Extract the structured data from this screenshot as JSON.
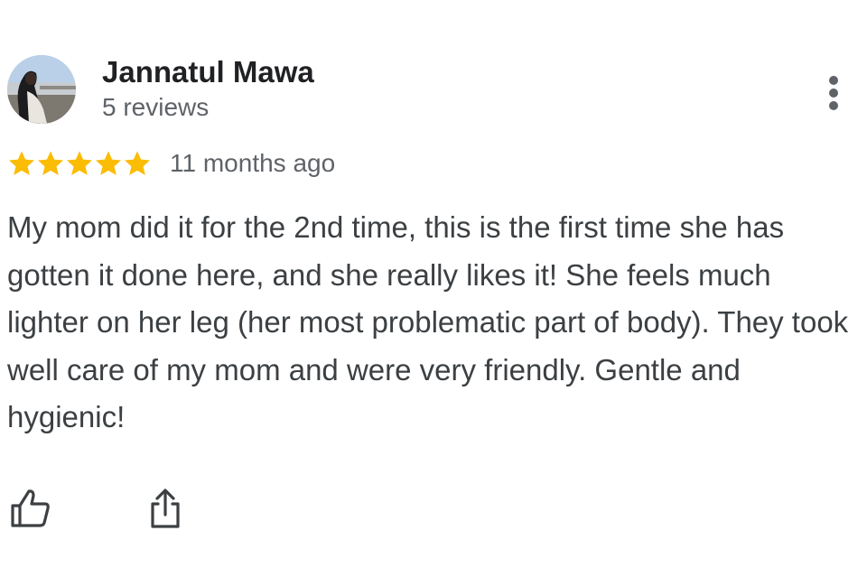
{
  "reviewer": {
    "name": "Jannatul Mawa",
    "review_count": "5 reviews",
    "avatar_icon": "user-avatar-photo"
  },
  "rating": {
    "stars": 5,
    "max_stars": 5,
    "star_color": "#fbbc04",
    "timestamp": "11 months ago"
  },
  "review": {
    "text": "My mom did it for the 2nd time, this is the first time she has gotten it done here, and she really likes it! She feels much lighter on her leg (her most problematic part of body). They took well care of my mom and were very friendly. Gentle and hygienic!"
  },
  "actions": {
    "more_icon": "more-vert-icon",
    "like_icon": "thumbs-up-icon",
    "share_icon": "share-icon",
    "icon_color": "#3c4043"
  }
}
